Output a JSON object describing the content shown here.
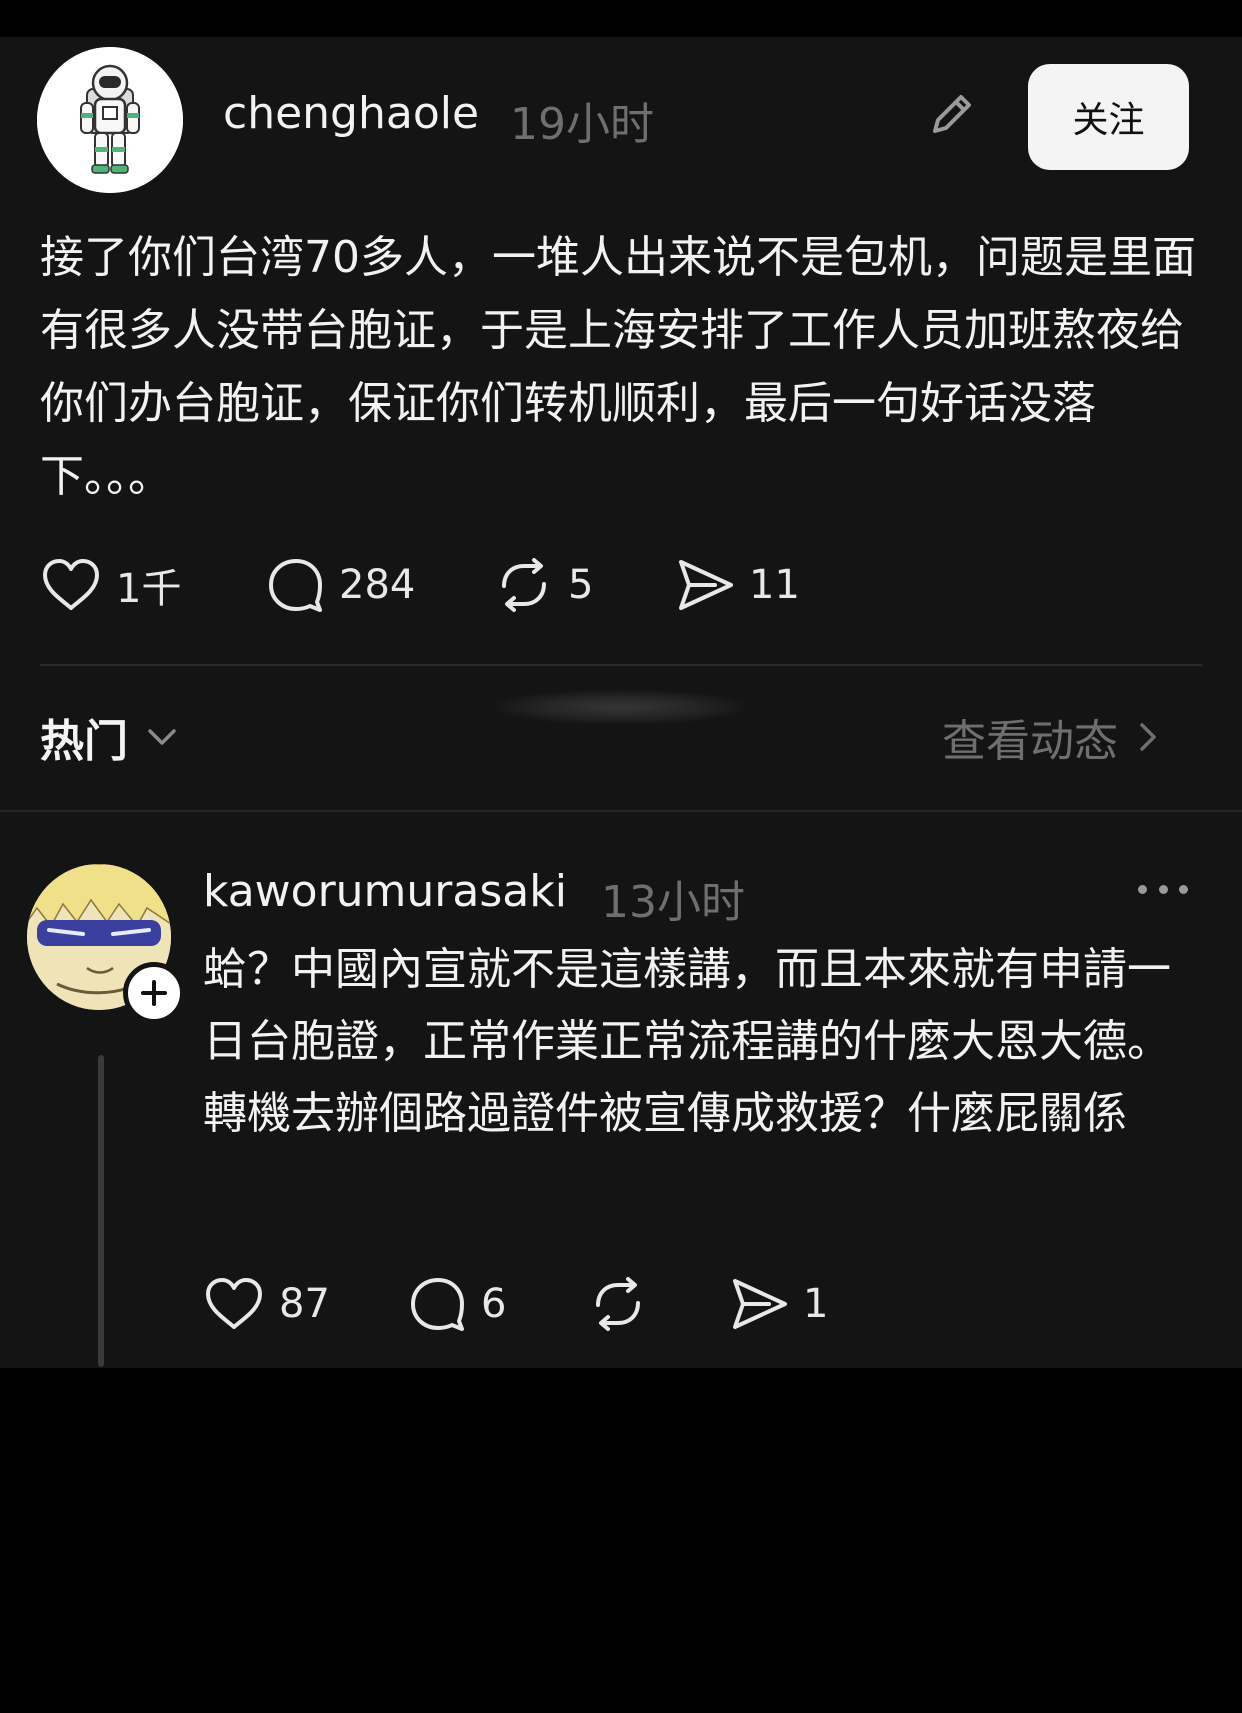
{
  "post": {
    "username": "chenghaole",
    "timestamp": "19小时",
    "follow_label": "关注",
    "body": "接了你们台湾70多人，一堆人出来说不是包机，问题是里面有很多人没带台胞证，于是上海安排了工作人员加班熬夜给你们办台胞证，保证你们转机顺利，最后一句好话没落下。。。",
    "likes": "1千",
    "comments": "284",
    "reposts": "5",
    "shares": "11"
  },
  "replies_bar": {
    "sort_label": "热门",
    "view_activity_label": "查看动态"
  },
  "reply": {
    "username": "kaworumurasaki",
    "timestamp": "13小时",
    "body": "蛤？中國內宣就不是這樣講，而且本來就有申請一日台胞證，正常作業正常流程講的什麼大恩大德。 轉機去辦個路過證件被宣傳成救援？什麼屁關係",
    "likes": "87",
    "comments": "6",
    "shares": "1"
  },
  "icons": {
    "like": "heart-icon",
    "comment": "speech-bubble-icon",
    "repost": "repost-arrows-icon",
    "share": "send-icon",
    "edit": "pencil-icon",
    "more": "more-dots-icon",
    "sort": "chevron-down-icon",
    "view": "chevron-right-icon",
    "follow_badge": "plus-icon"
  },
  "colors": {
    "background": "#000000",
    "panel": "#141414",
    "text": "#f2f2f2",
    "muted": "#6f6f6f",
    "follow_button_bg": "#f4f4f4"
  }
}
